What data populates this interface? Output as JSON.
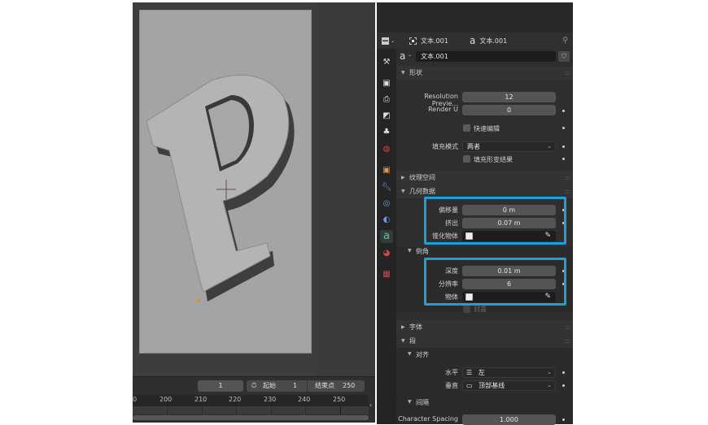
{
  "viewport": {
    "letter": "P",
    "cursor": "3d-cursor"
  },
  "timeline": {
    "current_frame": "1",
    "start_label": "起始",
    "start_value": "1",
    "end_label": "结束点",
    "end_value": "250",
    "ruler_ticks": [
      "0",
      "200",
      "210",
      "220",
      "230",
      "240",
      "250"
    ]
  },
  "properties": {
    "header": {
      "editor_icon": "properties-editor-icon",
      "object_icon": "object-icon",
      "object_name": "文本.001",
      "data_icon": "text-data-icon",
      "data_name": "文本.001",
      "pin_icon": "pin-icon"
    },
    "datablock": {
      "name": "文本.001",
      "fake_user_icon": "shield-icon"
    },
    "tabs": [
      {
        "name": "tool",
        "glyph": "🔧"
      },
      {
        "name": "render",
        "glyph": "📷"
      },
      {
        "name": "output",
        "glyph": "🖨"
      },
      {
        "name": "view-layer",
        "glyph": "🖼"
      },
      {
        "name": "scene",
        "glyph": "⚘"
      },
      {
        "name": "world",
        "glyph": "◉"
      },
      {
        "name": "object",
        "glyph": "■"
      },
      {
        "name": "modifiers",
        "glyph": "🔧"
      },
      {
        "name": "particles",
        "glyph": "◎"
      },
      {
        "name": "physics",
        "glyph": "◍"
      },
      {
        "name": "object-data",
        "glyph": "a",
        "active": true
      },
      {
        "name": "material",
        "glyph": "◕"
      },
      {
        "name": "texture",
        "glyph": "▦"
      }
    ],
    "panels": {
      "shape": {
        "title": "形状",
        "resolution_preview_label": "Resolution Previe...",
        "resolution_preview_value": "12",
        "render_u_label": "Render U",
        "render_u_value": "0",
        "fast_edit_label": "快速编辑",
        "fill_mode_label": "填充模式",
        "fill_mode_value": "两者",
        "fill_deformed_label": "填充形变结果"
      },
      "texture_space": {
        "title": "纹理空间"
      },
      "geometry": {
        "title": "几何数据",
        "offset_label": "偏移量",
        "offset_value": "0 m",
        "extrude_label": "挤出",
        "extrude_value": "0.07 m",
        "taper_label": "锥化物体",
        "bevel": {
          "title": "倒角",
          "depth_label": "深度",
          "depth_value": "0.01 m",
          "resolution_label": "分辨率",
          "resolution_value": "6",
          "object_label": "物体",
          "fill_caps_label": "封盖"
        }
      },
      "font": {
        "title": "字体"
      },
      "paragraph": {
        "title": "段",
        "alignment": {
          "title": "对齐",
          "horizontal_label": "水平",
          "horizontal_value": "左",
          "vertical_label": "垂直",
          "vertical_value": "顶部基线"
        },
        "spacing": {
          "title": "间隔",
          "character_spacing_label": "Character Spacing",
          "character_spacing_value": "1.000"
        }
      }
    },
    "highlight_color": "#1e9fdc"
  }
}
